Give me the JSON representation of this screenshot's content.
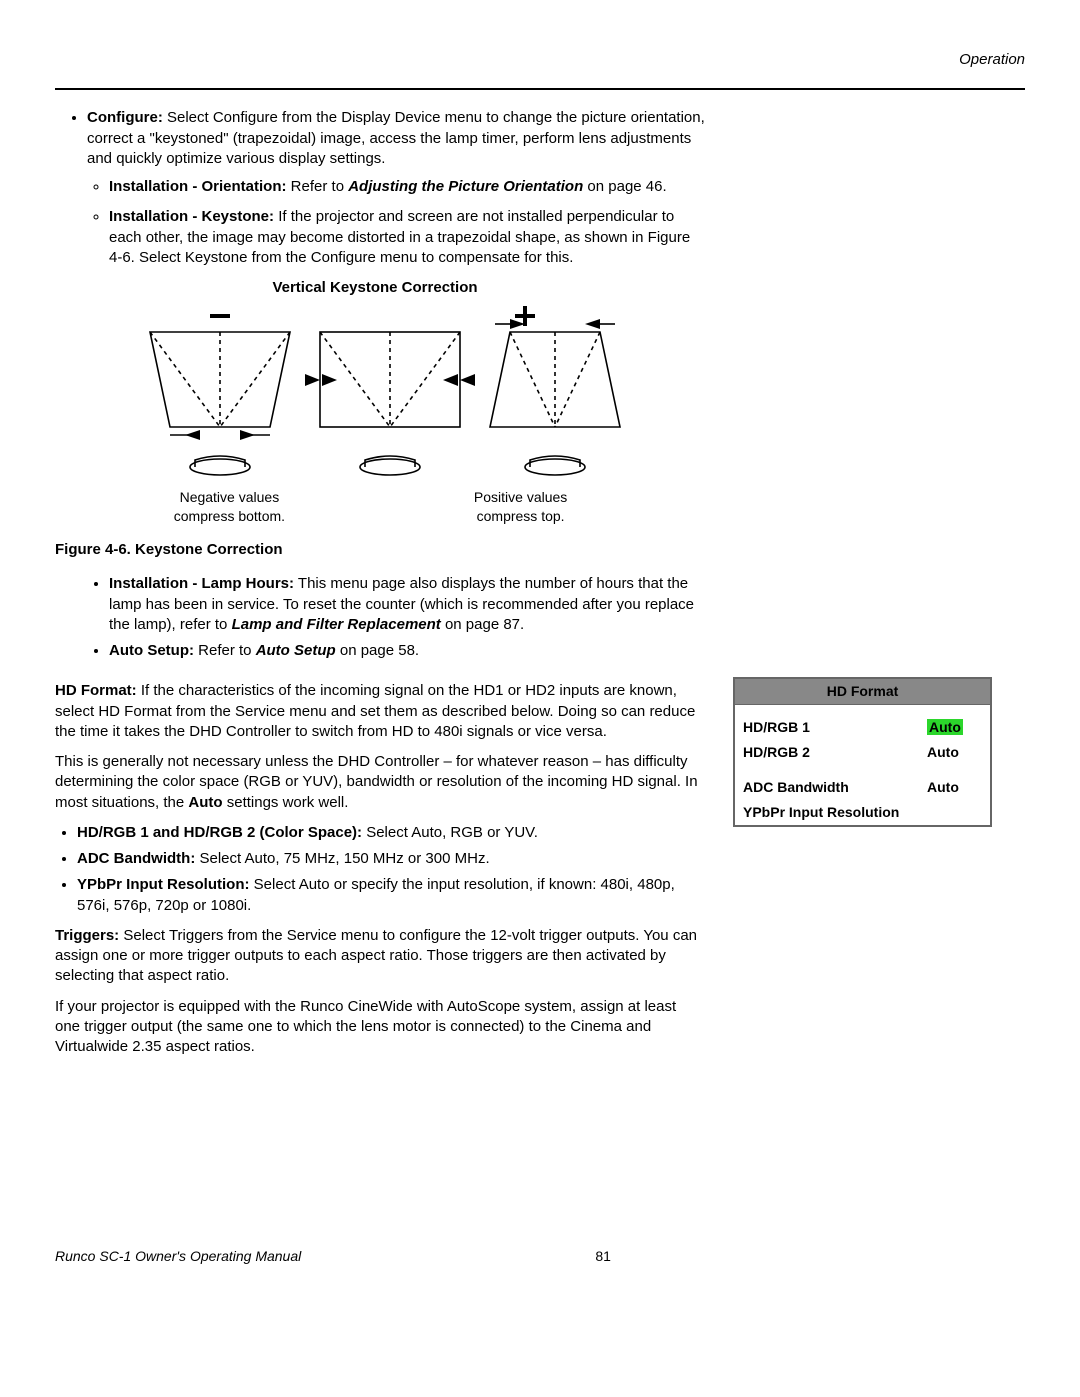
{
  "header": {
    "section": "Operation"
  },
  "configure": {
    "title": "Configure:",
    "text": " Select Configure from the Display Device menu to change the picture orientation, correct a \"keystoned\" (trapezoidal) image, access the lamp timer, perform lens adjustments and quickly optimize various display settings.",
    "orientation": {
      "title": "Installation - Orientation:",
      "pre": " Refer to ",
      "ref": "Adjusting the Picture Orientation",
      "post": " on page 46."
    },
    "keystone": {
      "title": "Installation - Keystone:",
      "text": " If the projector and screen are not installed perpendicular to each other, the image may become distorted in a trapezoidal shape, as shown in Figure 4-6. Select Keystone from the Configure menu to compensate for this."
    }
  },
  "diagram": {
    "title": "Vertical Keystone Correction",
    "neg_l1": "Negative values",
    "neg_l2": "compress bottom.",
    "pos_l1": "Positive values",
    "pos_l2": "compress top."
  },
  "figcap": "Figure 4-6. Keystone Correction",
  "lamp": {
    "title": "Installation - Lamp Hours:",
    "text": " This menu page also displays the number of hours that the lamp has been in service. To reset the counter (which is recommended after you replace the lamp), refer to ",
    "ref": "Lamp and Filter Replacement",
    "post": " on page 87."
  },
  "autosetup": {
    "title": "Auto Setup:",
    "pre": " Refer to ",
    "ref": "Auto Setup",
    "post": " on page 58."
  },
  "hdformat": {
    "title": "HD Format:",
    "p1": " If the characteristics of the incoming signal on the HD1 or HD2 inputs are known, select HD Format from the Service menu and set them as described below. Doing so can reduce the time it takes the DHD Controller to switch from HD to 480i signals or vice versa.",
    "p2a": "This is generally not necessary unless the DHD Controller – for whatever reason – has difficulty determining the color space (RGB or YUV), bandwidth or resolution of the incoming HD signal. In most situations, the ",
    "auto": "Auto",
    "p2b": " settings work well.",
    "b1t": "HD/RGB 1 and HD/RGB 2 (Color Space):",
    "b1": " Select Auto, RGB or YUV.",
    "b2t": "ADC Bandwidth:",
    "b2": " Select Auto, 75 MHz, 150 MHz or 300 MHz.",
    "b3t": "YPbPr Input Resolution:",
    "b3": " Select Auto or specify the input resolution, if known: 480i, 480p, 576i, 576p, 720p or 1080i."
  },
  "sidetable": {
    "header": "HD Format",
    "r1l": "HD/RGB 1",
    "r1v": "Auto",
    "r2l": "HD/RGB 2",
    "r2v": "Auto",
    "r3l": "ADC Bandwidth",
    "r3v": "Auto",
    "r4l": "YPbPr Input Resolution"
  },
  "triggers": {
    "title": "Triggers:",
    "p1": " Select Triggers from the Service menu to configure the 12-volt trigger outputs. You can assign one or more trigger outputs to each aspect ratio. Those triggers are then activated by selecting that aspect ratio.",
    "p2": "If your projector is equipped with the Runco CineWide with AutoScope system, assign at least one trigger output (the same one to which the lens motor is connected) to the Cinema and Virtualwide 2.35 aspect ratios."
  },
  "footer": {
    "left": "Runco SC-1 Owner's Operating Manual",
    "page": "81"
  }
}
